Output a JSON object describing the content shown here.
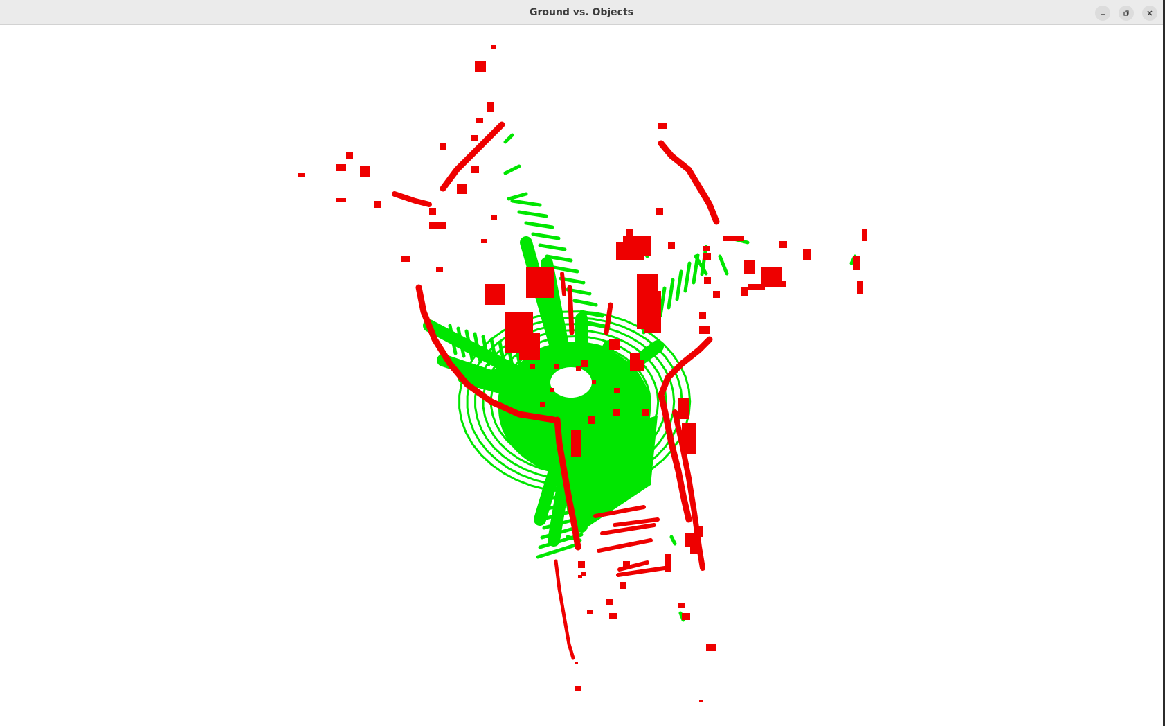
{
  "window": {
    "title": "Ground vs. Objects",
    "controls": [
      "minimize-icon",
      "restore-icon",
      "close-icon"
    ]
  },
  "visualization": {
    "type": "point-cloud-top-down",
    "colors": {
      "ground": "#00e600",
      "objects": "#ee0000",
      "background": "#ffffff",
      "titlebar": "#ebebeb"
    }
  }
}
